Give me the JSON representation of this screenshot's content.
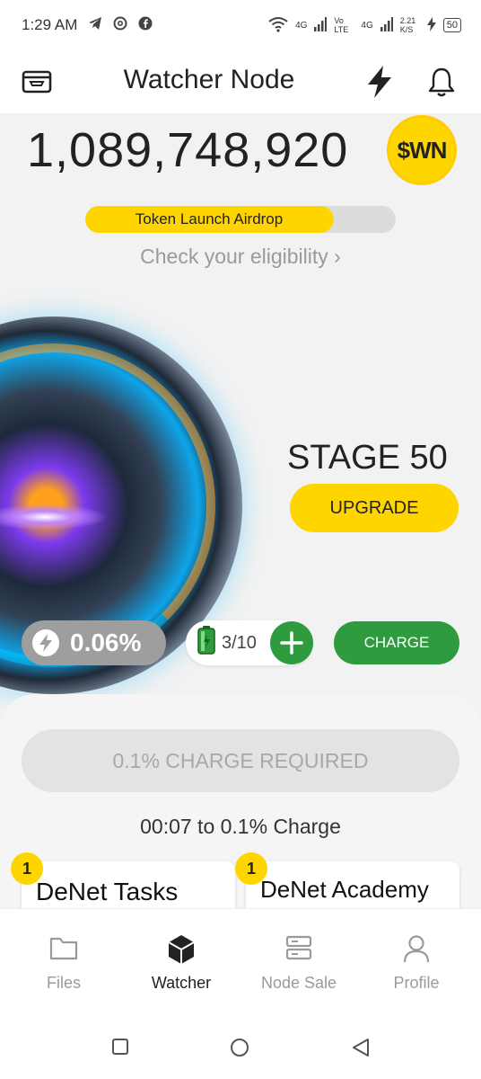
{
  "status_bar": {
    "time": "1:29 AM",
    "net1": "4G",
    "volte": "Vo LTE",
    "net2": "4G",
    "speed": "2.21 K/S",
    "battery": "50"
  },
  "header": {
    "title": "Watcher Node"
  },
  "balance": {
    "amount": "1,089,748,920",
    "token": "$WN"
  },
  "airdrop": {
    "label": "Token Launch Airdrop",
    "progress": 0.8,
    "link": "Check your eligibility ›"
  },
  "stage": {
    "label": "STAGE 50",
    "upgrade_label": "UPGRADE"
  },
  "stats": {
    "percent": "0.06%",
    "energy": "3/10",
    "charge_label": "CHARGE"
  },
  "panel": {
    "required_label": "0.1% CHARGE REQUIRED",
    "countdown": "00:07 to 0.1% Charge"
  },
  "cards": [
    {
      "badge": "1",
      "title": "DeNet Tasks"
    },
    {
      "badge": "1",
      "title": "DeNet Academy"
    }
  ],
  "nav": [
    {
      "label": "Files",
      "icon": "folder-icon"
    },
    {
      "label": "Watcher",
      "icon": "cube-icon"
    },
    {
      "label": "Node Sale",
      "icon": "server-icon"
    },
    {
      "label": "Profile",
      "icon": "person-icon"
    }
  ],
  "colors": {
    "accent_yellow": "#ffd500",
    "accent_green": "#2e9b3f",
    "muted_gray": "#9e9e9e"
  }
}
